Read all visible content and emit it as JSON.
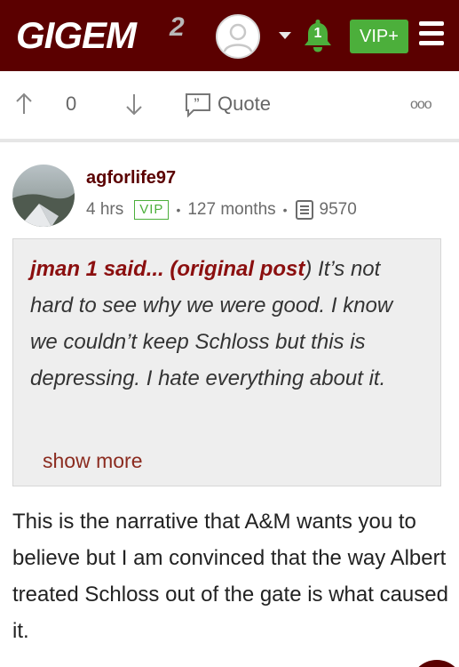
{
  "header": {
    "logo": "GIGEM",
    "logo_sup": "2",
    "notification_count": "1",
    "vip_label": "VIP+",
    "colors": {
      "bar": "#5b0000",
      "accent_green": "#4caf3b"
    }
  },
  "actions": {
    "vote_count": "0",
    "quote_label": "Quote",
    "more_icon": "ooo"
  },
  "post": {
    "username": "agforlife97",
    "time": "4 hrs",
    "badge": "VIP",
    "tenure": "127 months",
    "post_count": "9570",
    "quote": {
      "author": "jman 1 said... (original post",
      "paren_close": ")",
      "text": " It’s not hard to see why we were good. I know we couldn’t keep Schloss but this is depressing. I hate everything about it.",
      "show_more": "show more"
    },
    "body": "This is the narrative that A&M wants you to believe but I am convinced that the way Albert treated Schloss out of the gate is what caused it."
  }
}
